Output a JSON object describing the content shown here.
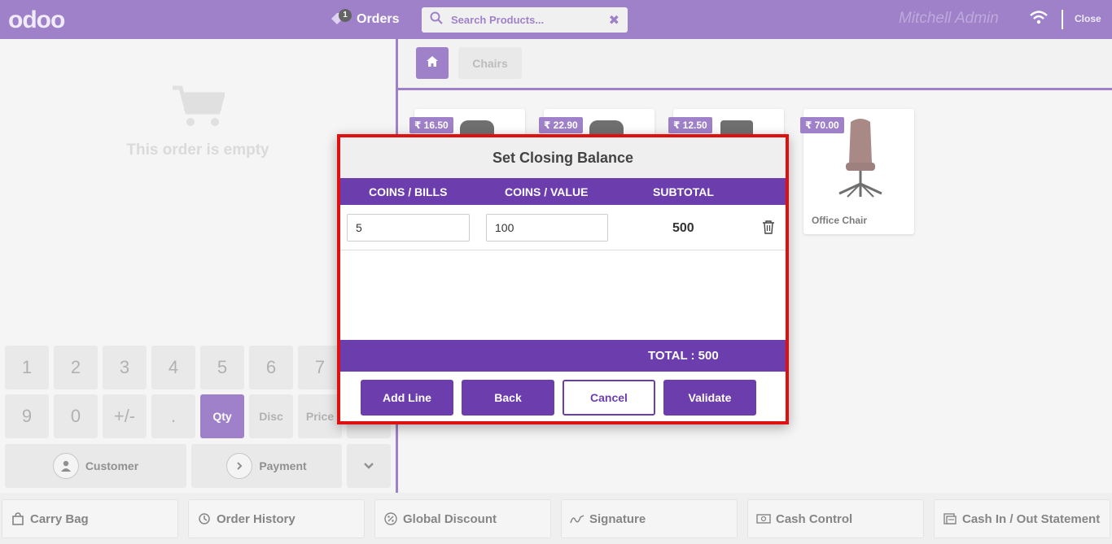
{
  "header": {
    "logo": "odoo",
    "orders_label": "Orders",
    "orders_count": "1",
    "search_placeholder": "Search Products...",
    "search_clear": "✖",
    "user": "Mitchell Admin",
    "close_label": "Close"
  },
  "order": {
    "empty_text": "This order is empty"
  },
  "numpad": {
    "row1": [
      "1",
      "2",
      "3",
      "4",
      "5",
      "6",
      "7"
    ],
    "row2": [
      "9",
      "0",
      "+/-",
      ".",
      "Qty",
      "Disc",
      "Price"
    ],
    "customer_label": "Customer",
    "payment_label": "Payment"
  },
  "categories": {
    "current": "Chairs"
  },
  "products": [
    {
      "price": "₹ 16.50"
    },
    {
      "price": "₹ 22.90"
    },
    {
      "price": "₹ 12.50"
    },
    {
      "price": "₹ 70.00",
      "name": "Office Chair"
    }
  ],
  "bottom_bar": [
    {
      "label": "Carry Bag",
      "icon": "bag-icon"
    },
    {
      "label": "Order History",
      "icon": "history-icon"
    },
    {
      "label": "Global Discount",
      "icon": "percent-icon"
    },
    {
      "label": "Signature",
      "icon": "signature-icon"
    },
    {
      "label": "Cash Control",
      "icon": "money-icon"
    },
    {
      "label": "Cash In / Out Statement",
      "icon": "statement-icon"
    }
  ],
  "modal": {
    "title": "Set Closing Balance",
    "col_coins_bills": "COINS / BILLS",
    "col_coins_value": "COINS / VALUE",
    "col_subtotal": "SUBTOTAL",
    "rows": [
      {
        "coins_bills": "5",
        "coins_value": "100",
        "subtotal": "500"
      }
    ],
    "total": "TOTAL : 500",
    "add_line": "Add Line",
    "back": "Back",
    "cancel": "Cancel",
    "validate": "Validate"
  },
  "colors": {
    "brand": "#6c3ead",
    "highlight_border": "#e01010"
  }
}
